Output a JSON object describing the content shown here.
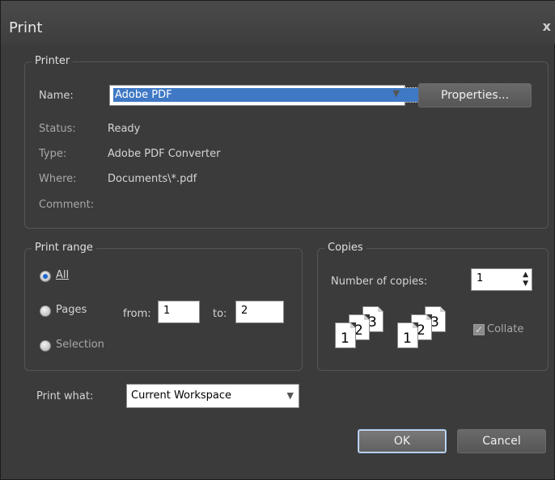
{
  "window": {
    "title": "Print",
    "close_glyph": "x"
  },
  "printer": {
    "legend": "Printer",
    "name_label": "Name:",
    "name_value": "Adobe PDF",
    "properties_label": "Properties...",
    "status_label": "Status:",
    "status_value": "Ready",
    "type_label": "Type:",
    "type_value": "Adobe PDF Converter",
    "where_label": "Where:",
    "where_value": "Documents\\*.pdf",
    "comment_label": "Comment:"
  },
  "print_range": {
    "legend": "Print range",
    "all_label": "All",
    "pages_label": "Pages",
    "from_label": "from:",
    "from_value": "1",
    "to_label": "to:",
    "to_value": "2",
    "selection_label": "Selection",
    "selected": "All"
  },
  "copies": {
    "legend": "Copies",
    "number_label": "Number of copies:",
    "number_value": "1",
    "collate_label": "Collate",
    "collate_checked": true,
    "collate_pages": [
      "1",
      "2",
      "3"
    ]
  },
  "print_what": {
    "label": "Print what:",
    "value": "Current Workspace"
  },
  "buttons": {
    "ok": "OK",
    "cancel": "Cancel"
  },
  "colors": {
    "background": "#3b3b3b",
    "selection": "#3f78c4",
    "title_bar": "#4a4a4a"
  }
}
